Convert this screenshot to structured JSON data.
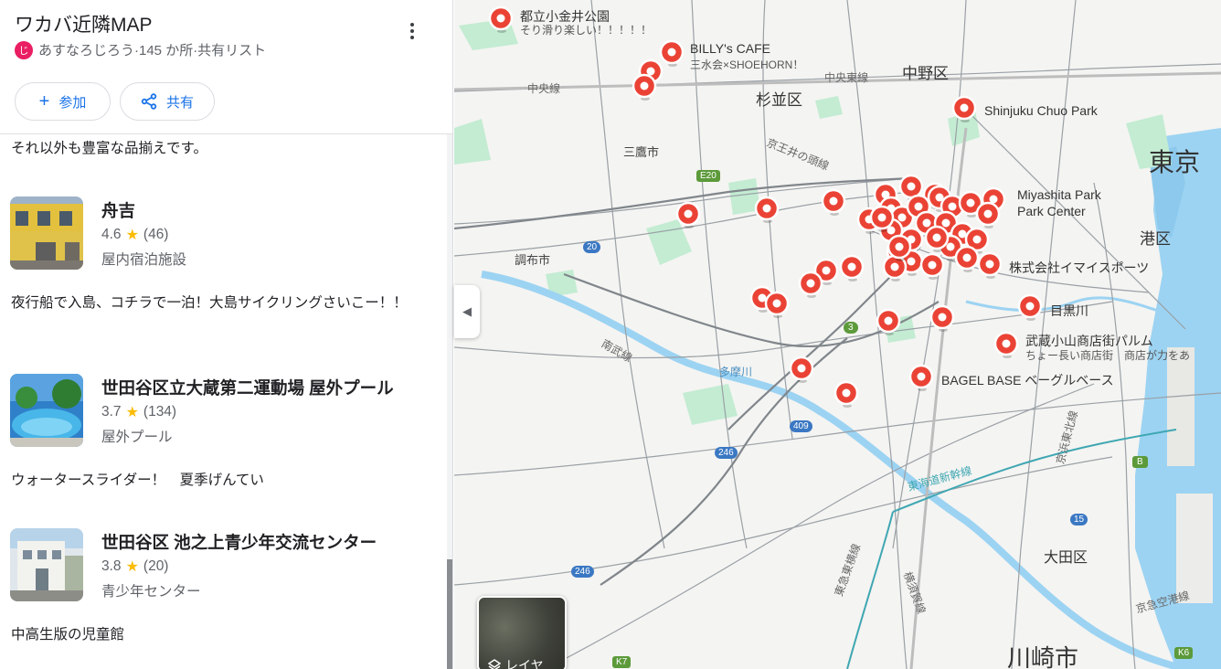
{
  "list": {
    "title": "ワカバ近隣MAP",
    "owner_initial": "じ",
    "owner": "あすなろじろう·145 か所·共有リスト",
    "join_label": "参加",
    "share_label": "共有"
  },
  "notes": {
    "top": "それ以外も豊富な品揃えです。",
    "funakichi": "夜行船で入島、コチラで一泊！大島サイクリングさいこー！！",
    "pool": "ウォータースライダー！　夏季げんてい",
    "center": "中高生版の児童館"
  },
  "places": [
    {
      "name": "舟吉",
      "rating": "4.6",
      "reviews": "(46)",
      "category": "屋内宿泊施設"
    },
    {
      "name": "世田谷区立大蔵第二運動場 屋外プール",
      "rating": "3.7",
      "reviews": "(134)",
      "category": "屋外プール"
    },
    {
      "name": "世田谷区 池之上青少年交流センター",
      "rating": "3.8",
      "reviews": "(20)",
      "category": "青少年センター"
    }
  ],
  "map": {
    "layers_label": "レイヤ",
    "labels": {
      "koganei": "都立小金井公園",
      "koganei_sub": "そり滑り楽しい！！！！！",
      "billys": "BILLY's CAFE",
      "billys_sub": "三水会×SHOEHORN！",
      "nakano": "中野区",
      "suginami": "杉並区",
      "chuo_line_w": "中央線",
      "chuo_line_e": "中央東線",
      "shinjuku_park": "Shinjuku Chuo Park",
      "tokyo": "東京",
      "mitaka": "三鷹市",
      "keio_inokashira": "京王井の頭線",
      "miyashita": "Miyashita Park",
      "miyashita2": "Park Center",
      "minato": "港区",
      "chofu": "調布市",
      "imaisports": "株式会社イマイスポーツ",
      "meguro": "目黒川",
      "musashikoyama": "武蔵小山商店街パルム",
      "musashikoyama_sub": "ちょー長い商店街　商店が力をあ",
      "nanbu": "南武線",
      "tamagawa": "多摩川",
      "bagel": "BAGEL BASE ベーグルベース",
      "tokaido": "東海道新幹線",
      "keihin": "京浜東北線",
      "ota": "大田区",
      "tokyu_toyoko": "東急東横線",
      "yokosuka": "横須賀線",
      "keikyu": "京急空港線",
      "kawasaki": "川崎市",
      "road_e20": "E20",
      "road_20": "20",
      "road_3": "3",
      "road_409": "409",
      "road_246a": "246",
      "road_246b": "246",
      "road_15": "15",
      "road_b": "B",
      "road_k7": "K7",
      "road_k6": "K6"
    }
  },
  "colors": {
    "accent": "#1a73e8",
    "pin": "#ea4335",
    "star": "#fbbc04",
    "water": "#9cd3f2",
    "park": "#c3ecd2"
  }
}
